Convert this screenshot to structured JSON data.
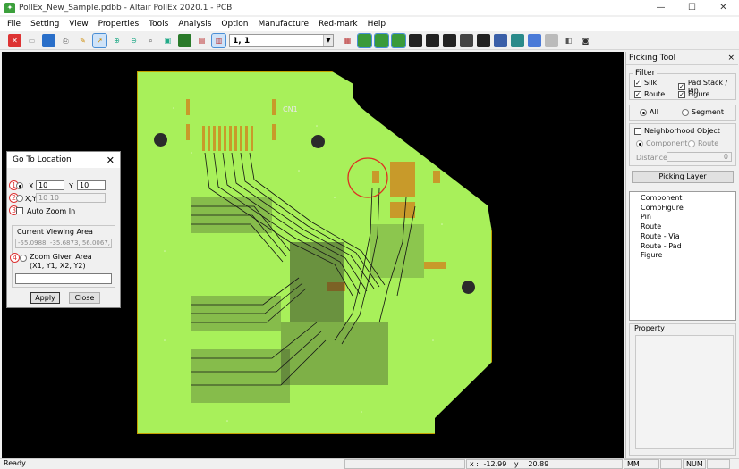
{
  "window": {
    "title": "PollEx_New_Sample.pdbb - Altair PollEx 2020.1 - PCB",
    "app_icon": "pcb-app-icon",
    "controls": {
      "minimize": "—",
      "maximize": "☐",
      "close": "✕"
    }
  },
  "menu": [
    "File",
    "Setting",
    "View",
    "Properties",
    "Tools",
    "Analysis",
    "Option",
    "Manufacture",
    "Red-mark",
    "Help"
  ],
  "toolbar": {
    "layer_combo_value": "1, 1"
  },
  "board": {
    "label": "CN1",
    "colors": {
      "board": "#a8f05a",
      "copper": "#c89a2a",
      "background": "#000000"
    }
  },
  "goto": {
    "title": "Go To Location",
    "close": "✕",
    "markers": [
      "1",
      "2",
      "3",
      "4"
    ],
    "x_label": "X",
    "x_value": "10",
    "y_label": "Y",
    "y_value": "10",
    "xy_label": "X,Y",
    "xy_value": "10 10",
    "auto_zoom": "Auto Zoom In",
    "viewing_area_label": "Current Viewing Area",
    "viewing_area_value": "-55.0988, -35.6873, 56.0067,",
    "zoom_given_label": "Zoom Given Area",
    "zoom_given_sub": "(X1, Y1, X2, Y2)",
    "apply": "Apply",
    "close_btn": "Close"
  },
  "picking": {
    "title": "Picking Tool",
    "pin": "×",
    "filter": {
      "label": "Filter",
      "silk": "Silk",
      "pad_stack": "Pad Stack / Pin",
      "route": "Route",
      "figure": "Figure"
    },
    "all": "All",
    "segment": "Segment",
    "neighborhood": "Neighborhood Object",
    "component": "Component",
    "route_opt": "Route",
    "distance_label": "Distance",
    "distance_value": "0",
    "picking_layer": "Picking Layer",
    "layers": [
      "Component",
      "CompFigure",
      "Pin",
      "Route",
      "Route - Via",
      "Route - Pad",
      "Figure"
    ],
    "property_label": "Property"
  },
  "status": {
    "ready": "Ready",
    "x_label": "x :",
    "x_value": "-12.99",
    "y_label": "y :",
    "y_value": "20.89",
    "unit": "MM",
    "num": "NUM"
  }
}
